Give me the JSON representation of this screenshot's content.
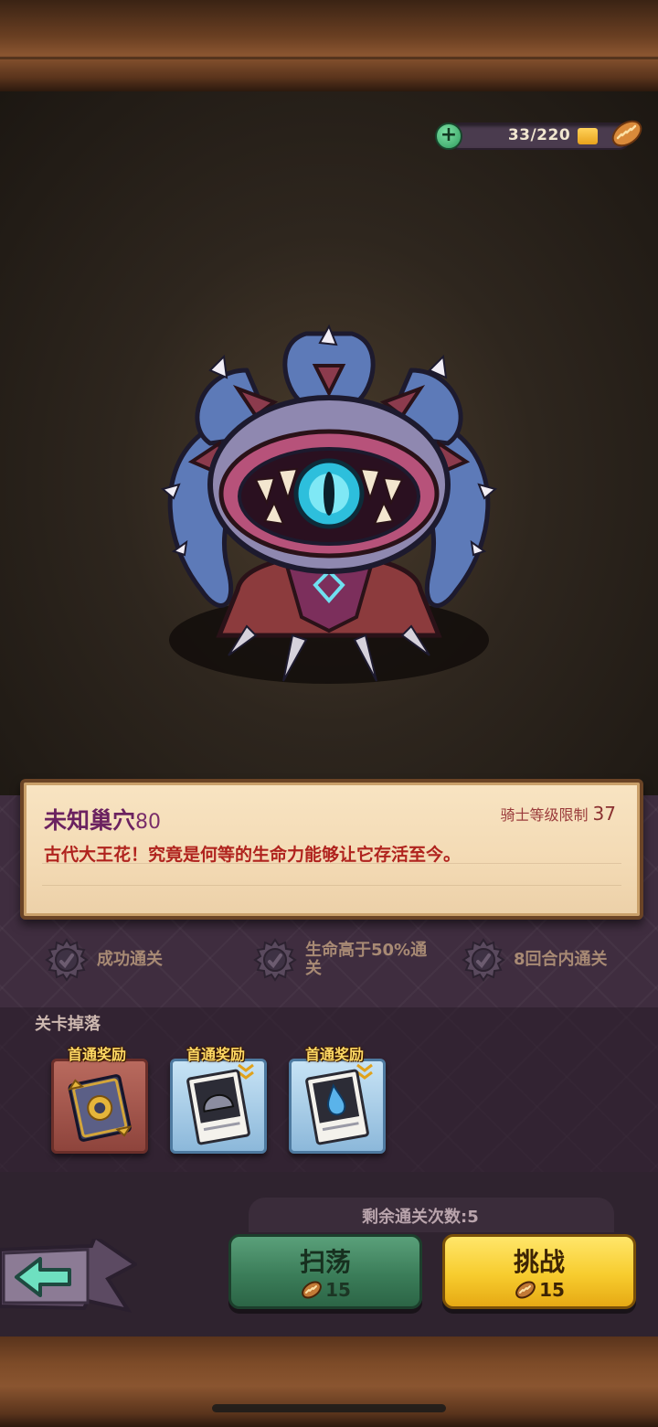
{
  "energy": {
    "text": "33/220"
  },
  "stage": {
    "title": "未知巢穴",
    "number": "80",
    "level_limit_label": "骑士等级限制",
    "level_limit_value": "37",
    "description": "古代大王花！究竟是何等的生命力能够让它存活至今。"
  },
  "objectives": [
    {
      "label": "成功通关"
    },
    {
      "label": "生命高于50%通关"
    },
    {
      "label": "8回合内通关"
    }
  ],
  "drops": {
    "heading": "关卡掉落",
    "items": [
      {
        "tag": "首通奖励",
        "icon": "spellbook-icon"
      },
      {
        "tag": "首通奖励",
        "icon": "helmet-card-icon"
      },
      {
        "tag": "首通奖励",
        "icon": "potion-card-icon"
      }
    ]
  },
  "remaining": {
    "text": "剩余通关次数:5"
  },
  "buttons": {
    "sweep": {
      "label": "扫荡",
      "cost": "15"
    },
    "challenge": {
      "label": "挑战",
      "cost": "15"
    }
  },
  "colors": {
    "accent_green": "#3b7d59",
    "accent_yellow": "#f7cc2e",
    "title_purple": "#6b2260",
    "desc_red": "#b0231e"
  }
}
